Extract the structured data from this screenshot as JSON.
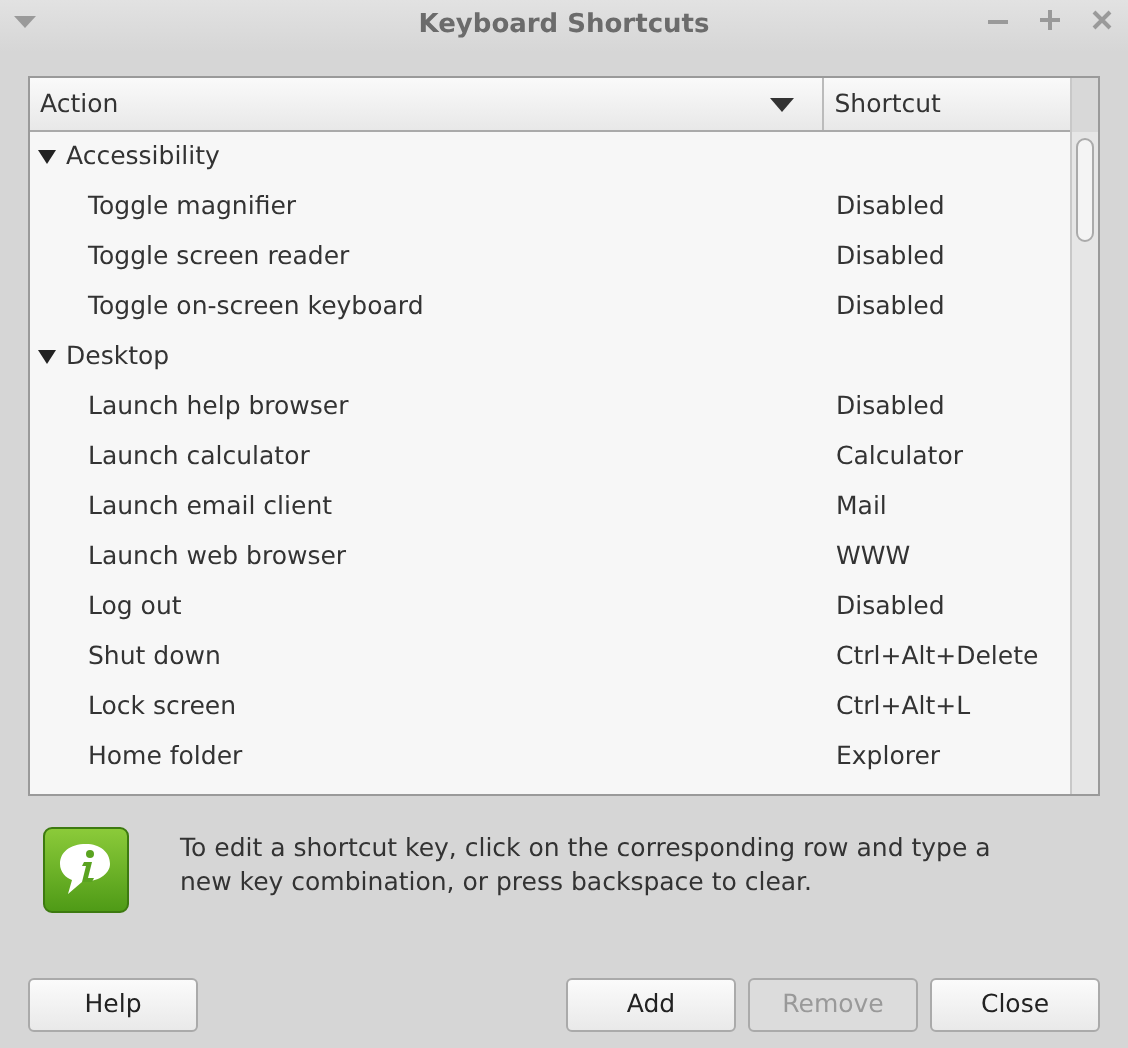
{
  "window": {
    "title": "Keyboard Shortcuts"
  },
  "table": {
    "columns": [
      "Action",
      "Shortcut"
    ],
    "groups": [
      {
        "name": "Accessibility",
        "expanded": true,
        "children": [
          {
            "action": "Toggle magnifier",
            "shortcut": "Disabled"
          },
          {
            "action": "Toggle screen reader",
            "shortcut": "Disabled"
          },
          {
            "action": "Toggle on-screen keyboard",
            "shortcut": "Disabled"
          }
        ]
      },
      {
        "name": "Desktop",
        "expanded": true,
        "children": [
          {
            "action": "Launch help browser",
            "shortcut": "Disabled"
          },
          {
            "action": "Launch calculator",
            "shortcut": "Calculator"
          },
          {
            "action": "Launch email client",
            "shortcut": "Mail"
          },
          {
            "action": "Launch web browser",
            "shortcut": "WWW"
          },
          {
            "action": "Log out",
            "shortcut": "Disabled"
          },
          {
            "action": "Shut down",
            "shortcut": "Ctrl+Alt+Delete"
          },
          {
            "action": "Lock screen",
            "shortcut": "Ctrl+Alt+L"
          },
          {
            "action": "Home folder",
            "shortcut": "Explorer"
          }
        ]
      }
    ]
  },
  "info": "To edit a shortcut key, click on the corresponding row and type a new key combination, or press backspace to clear.",
  "buttons": [
    {
      "label": "Help",
      "disabled": false
    },
    {
      "label": "Add",
      "disabled": false
    },
    {
      "label": "Remove",
      "disabled": true
    },
    {
      "label": "Close",
      "disabled": false
    }
  ]
}
